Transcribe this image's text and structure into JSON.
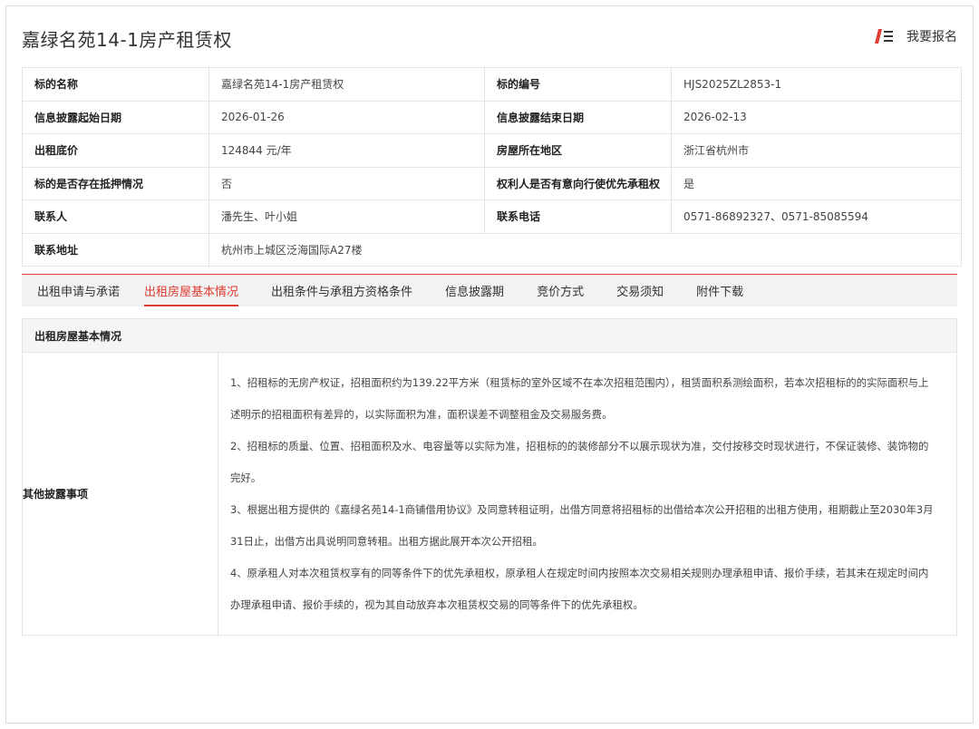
{
  "page": {
    "title": "嘉绿名苑14-1房产租赁权",
    "signup_label": "我要报名"
  },
  "info": {
    "rows": [
      {
        "k1": "标的名称",
        "v1": "嘉绿名苑14-1房产租赁权",
        "k2": "标的编号",
        "v2": "HJS2025ZL2853-1"
      },
      {
        "k1": "信息披露起始日期",
        "v1": "2026-01-26",
        "k2": "信息披露结束日期",
        "v2": "2026-02-13"
      },
      {
        "k1": "出租底价",
        "v1": "124844 元/年",
        "k2": "房屋所在地区",
        "v2": "浙江省杭州市"
      },
      {
        "k1": "标的是否存在抵押情况",
        "v1": "否",
        "k2": "权利人是否有意向行使优先承租权",
        "v2": "是"
      },
      {
        "k1": "联系人",
        "v1": "潘先生、叶小姐",
        "k2": "联系电话",
        "v2": "0571-86892327、0571-85085594"
      },
      {
        "k1": "联系地址",
        "v1": "杭州市上城区泛海国际A27楼"
      }
    ]
  },
  "tabs": [
    {
      "label": "出租申请与承诺"
    },
    {
      "label": "出租房屋基本情况"
    },
    {
      "label": "出租条件与承租方资格条件"
    },
    {
      "label": "信息披露期"
    },
    {
      "label": "竞价方式"
    },
    {
      "label": "交易须知"
    },
    {
      "label": "附件下载"
    }
  ],
  "active_tab": "出租房屋基本情况",
  "section": {
    "title": "出租房屋基本情况",
    "row_label": "其他披露事项",
    "lines": [
      "1、招租标的无房产权证，招租面积约为139.22平方米（租赁标的室外区域不在本次招租范围内），租赁面积系测绘面积，若本次招租标的的实际面积与上",
      "述明示的招租面积有差异的，以实际面积为准，面积误差不调整租金及交易服务费。",
      "2、招租标的质量、位置、招租面积及水、电容量等以实际为准，招租标的的装修部分不以展示现状为准，交付按移交时现状进行，不保证装修、装饰物的",
      "完好。",
      "3、根据出租方提供的《嘉绿名苑14-1商铺借用协议》及同意转租证明，出借方同意将招租标的出借给本次公开招租的出租方使用，租期截止至2030年3月",
      "31日止，出借方出具说明同意转租。出租方据此展开本次公开招租。",
      "4、原承租人对本次租赁权享有的同等条件下的优先承租权，原承租人在规定时间内按照本次交易相关规则办理承租申请、报价手续，若其未在规定时间内",
      "办理承租申请、报价手续的，视为其自动放弃本次租赁权交易的同等条件下的优先承租权。"
    ]
  },
  "colors": {
    "accent": "#e03c31",
    "border": "#e5e5e5",
    "tab_bg": "#f2f2f2"
  },
  "icons": {
    "signup": "signup-icon"
  }
}
